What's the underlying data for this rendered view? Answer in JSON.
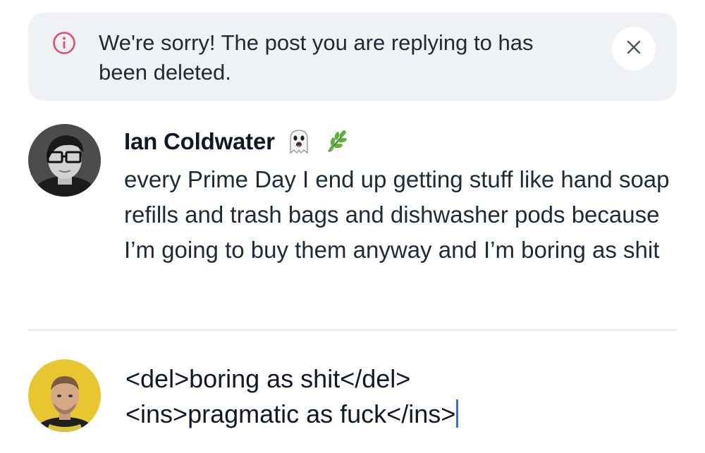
{
  "alert": {
    "message": "We're sorry! The post you are replying to has been deleted.",
    "icon": "info-circle-icon",
    "icon_color": "#e34d6b",
    "close_icon": "close-icon",
    "background": "#eef2f4"
  },
  "post": {
    "author_name": "Ian Coldwater",
    "author_emojis": [
      "ghost-emoji",
      "herb-emoji"
    ],
    "body": "every Prime Day I end up getting stuff like hand soap refills and trash bags and dishwasher pods because I’m going to buy them anyway and I’m boring as shit"
  },
  "composer": {
    "line1": "<del>boring as shit</del>",
    "line2": "<ins>pragmatic as fuck</ins>",
    "caret_color": "#3b6ce0"
  }
}
